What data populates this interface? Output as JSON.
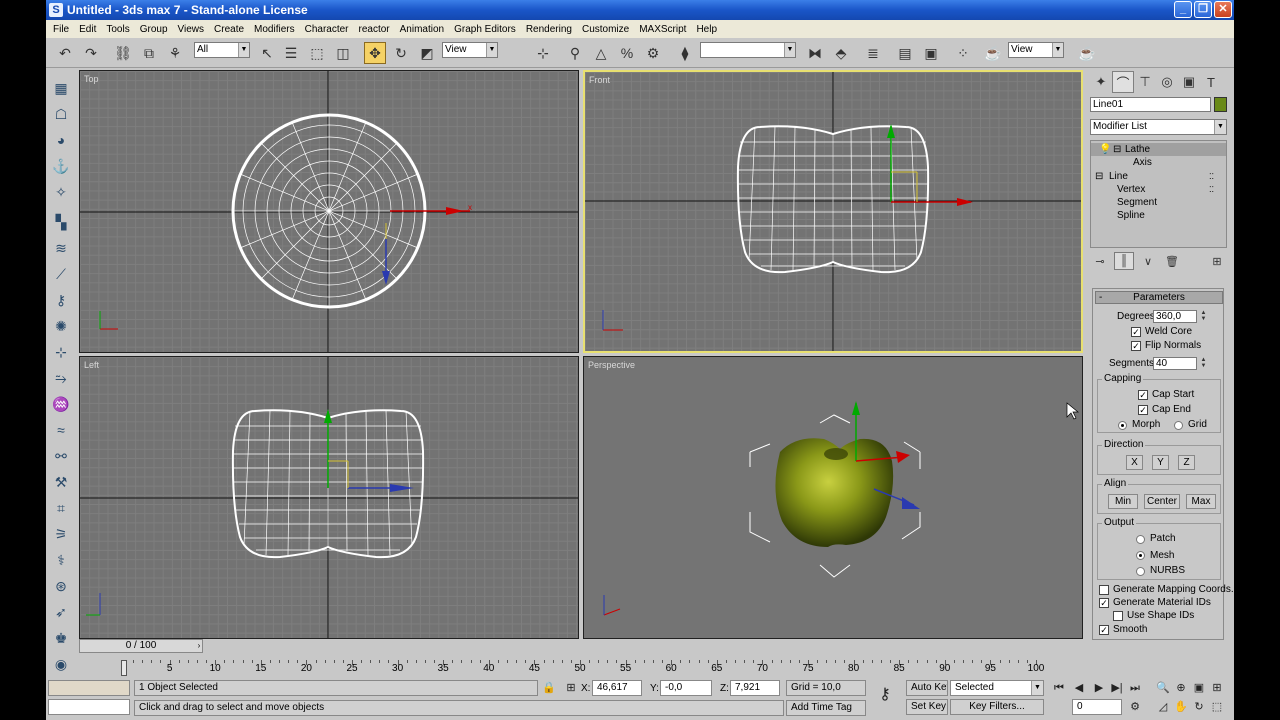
{
  "window": {
    "title": "Untitled - 3ds max 7 - Stand-alone License"
  },
  "menu": [
    "File",
    "Edit",
    "Tools",
    "Group",
    "Views",
    "Create",
    "Modifiers",
    "Character",
    "reactor",
    "Animation",
    "Graph Editors",
    "Rendering",
    "Customize",
    "MAXScript",
    "Help"
  ],
  "toolbar": {
    "selection_filter": "All",
    "ref_coord": "View",
    "named_selection": "",
    "render_view": "View"
  },
  "viewports": {
    "top": "Top",
    "front": "Front",
    "left": "Left",
    "perspective": "Perspective"
  },
  "axis": {
    "x": "x",
    "y": "y",
    "z": "z"
  },
  "command_panel": {
    "object_name": "Line01",
    "modifier_list": "Modifier List",
    "stack": {
      "lathe": "Lathe",
      "axis": "Axis",
      "line": "Line",
      "vertex": "Vertex",
      "segment": "Segment",
      "spline": "Spline"
    },
    "rollout_title": "Parameters",
    "rollout_minus": "-",
    "degrees_label": "Degrees:",
    "degrees_value": "360,0",
    "weld_core": "Weld Core",
    "flip_normals": "Flip Normals",
    "segments_label": "Segments:",
    "segments_value": "40",
    "capping": {
      "title": "Capping",
      "cap_start": "Cap Start",
      "cap_end": "Cap End",
      "morph": "Morph",
      "grid": "Grid"
    },
    "direction": {
      "title": "Direction",
      "x": "X",
      "y": "Y",
      "z": "Z"
    },
    "align": {
      "title": "Align",
      "min": "Min",
      "center": "Center",
      "max": "Max"
    },
    "output": {
      "title": "Output",
      "patch": "Patch",
      "mesh": "Mesh",
      "nurbs": "NURBS"
    },
    "gen_mapping": "Generate Mapping Coords.",
    "gen_material": "Generate Material IDs",
    "use_shape": "Use Shape IDs",
    "smooth": "Smooth"
  },
  "timeline": {
    "frame": "0 / 100",
    "ticks": [
      "0",
      "5",
      "10",
      "15",
      "20",
      "25",
      "30",
      "35",
      "40",
      "45",
      "50",
      "55",
      "60",
      "65",
      "70",
      "75",
      "80",
      "85",
      "90",
      "95",
      "100"
    ]
  },
  "statusbar": {
    "selection": "1 Object Selected",
    "prompt": "Click and drag to select and move objects",
    "x_label": "X:",
    "x_value": "46,617",
    "y_label": "Y:",
    "y_value": "-0,0",
    "z_label": "Z:",
    "z_value": "7,921",
    "grid": "Grid = 10,0",
    "add_time_tag": "Add Time Tag",
    "auto_key": "Auto Key",
    "set_key": "Set Key",
    "selected": "Selected",
    "key_filters": "Key Filters...",
    "frame_value": "0"
  }
}
